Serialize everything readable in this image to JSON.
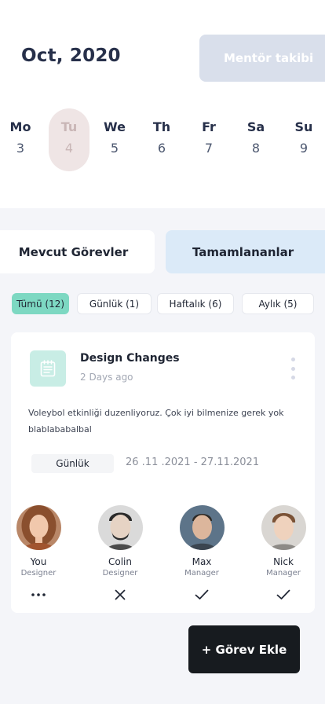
{
  "header": {
    "month": "Oct, 2020",
    "mentor_button": "Mentör takibi"
  },
  "calendar": {
    "selected_index": 1,
    "days": [
      {
        "name": "Mo",
        "date": "3"
      },
      {
        "name": "Tu",
        "date": "4"
      },
      {
        "name": "We",
        "date": "5"
      },
      {
        "name": "Th",
        "date": "6"
      },
      {
        "name": "Fr",
        "date": "7"
      },
      {
        "name": "Sa",
        "date": "8"
      },
      {
        "name": "Su",
        "date": "9"
      }
    ]
  },
  "tabs": [
    {
      "label": "Mevcut Görevler"
    },
    {
      "label": "Tamamlananlar"
    }
  ],
  "filters": [
    {
      "label": "Tümü (12)",
      "active": true
    },
    {
      "label": "Günlük (1)"
    },
    {
      "label": "Haftalık (6)"
    },
    {
      "label": "Aylık (5)"
    }
  ],
  "task": {
    "icon": "notepad-icon",
    "title": "Design Changes",
    "time": "2 Days ago",
    "description": "Voleybol etkinliği duzenliyoruz. Çok iyi bilmenize gerek yok blablababalbal",
    "period": "Günlük",
    "date_range": "26 .11 .2021 - 27.11.2021",
    "members": [
      {
        "name": "You",
        "role": "Designer",
        "status": "more-icon"
      },
      {
        "name": "Colin",
        "role": "Designer",
        "status": "close-icon"
      },
      {
        "name": "Max",
        "role": "Manager",
        "status": "check-icon"
      },
      {
        "name": "Nick",
        "role": "Manager",
        "status": "check-icon"
      }
    ]
  },
  "add_task_button": "+ Görev Ekle",
  "colors": {
    "accent_green": "#7dd8c2",
    "tab_blue": "#dbeaf8",
    "mentor_button_bg": "#d9dfeb",
    "selected_day_bg": "#efe5e5",
    "dark_button": "#171b1f"
  }
}
